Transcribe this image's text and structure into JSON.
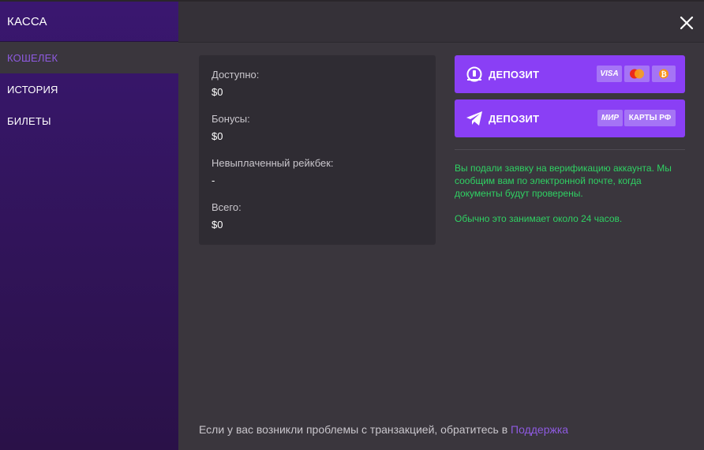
{
  "sidebar": {
    "title": "КАССА",
    "items": [
      {
        "label": "КОШЕЛЕК"
      },
      {
        "label": "ИСТОРИЯ"
      },
      {
        "label": "БИЛЕТЫ"
      }
    ]
  },
  "balance": {
    "available_label": "Доступно:",
    "available_value": "$0",
    "bonus_label": "Бонусы:",
    "bonus_value": "$0",
    "rakeback_label": "Невыплаченный рейкбек:",
    "rakeback_value": "-",
    "total_label": "Всего:",
    "total_value": "$0"
  },
  "deposit_buttons": [
    {
      "label": "ДЕПОЗИТ",
      "icon": "deposit-coin-icon",
      "badges": [
        "VISA",
        "",
        ""
      ]
    },
    {
      "label": "ДЕПОЗИТ",
      "icon": "telegram-icon",
      "badges": [
        "МИР",
        "КАРТЫ РФ"
      ]
    }
  ],
  "verification": {
    "line1": "Вы подали заявку на верификацию аккаунта. Мы сообщим вам по электронной почте, когда документы будут проверены.",
    "line2": "Обычно это занимает около 24 часов."
  },
  "footer": {
    "text": "Если у вас возникли проблемы с транзакцией, обратитесь в ",
    "link": "Поддержка"
  },
  "colors": {
    "accent": "#8a3ff5",
    "sidebar": "#3a1770",
    "success": "#2fd163",
    "background": "#3a363d"
  }
}
